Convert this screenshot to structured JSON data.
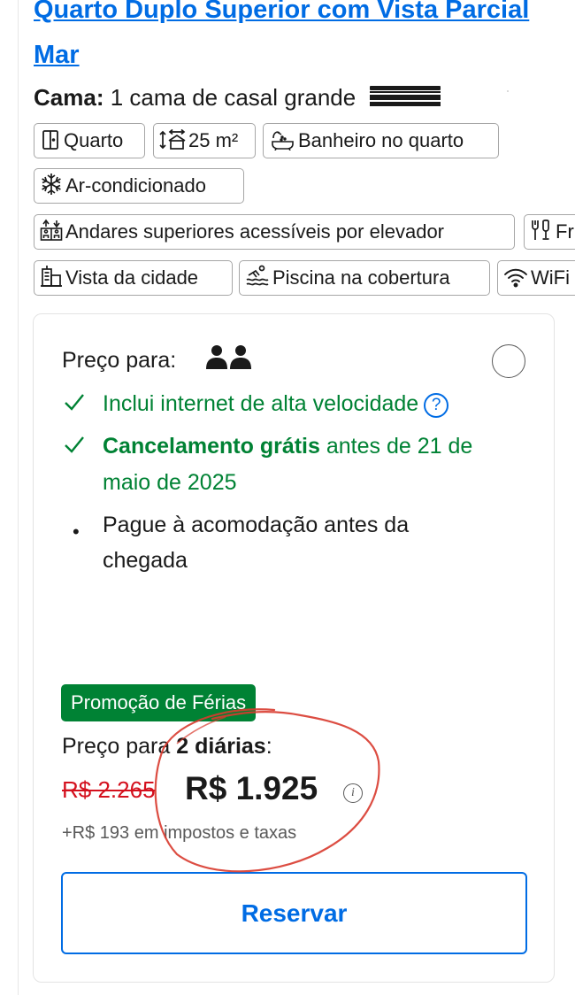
{
  "room": {
    "title_line1": "Quarto Duplo Superior com Vista Parcial",
    "title_line2": "Mar",
    "bed_label": "Cama:",
    "bed_value": "1 cama de casal grande"
  },
  "amenities": [
    {
      "label": "Quarto",
      "icon": "door-icon"
    },
    {
      "label": "25 m²",
      "icon": "room-size-icon"
    },
    {
      "label": "Banheiro no quarto",
      "icon": "bath-icon"
    },
    {
      "label": "Ar-condicionado",
      "icon": "snowflake-icon"
    },
    {
      "label": "Andares superiores acessíveis por elevador",
      "icon": "elevator-icon"
    },
    {
      "label": "Fr",
      "icon": "minibar-icon"
    },
    {
      "label": "Vista da cidade",
      "icon": "city-icon"
    },
    {
      "label": "Piscina na cobertura",
      "icon": "pool-icon"
    },
    {
      "label": "WiFi",
      "icon": "wifi-icon"
    }
  ],
  "offer": {
    "price_for_label": "Preço para:",
    "perks": [
      {
        "text": "Inclui internet de alta velocidade",
        "help": "?"
      },
      {
        "bold": "Cancelamento grátis",
        "text": " antes de 21 de maio de 2025"
      }
    ],
    "payment_note": "Pague à acomodação antes da chegada",
    "promo_badge": "Promoção de Férias",
    "nights_prefix": "Preço para ",
    "nights_bold": "2 diárias",
    "nights_suffix": ":",
    "old_price": "R$ 2.265",
    "new_price": "R$ 1.925",
    "info_glyph": "i",
    "taxes": "+R$ 193 em impostos e taxas",
    "reserve_label": "Reservar"
  },
  "colors": {
    "link_blue": "#006ce4",
    "green": "#008234",
    "red_strike": "#d4111e",
    "annotation_red": "#d83a2e"
  }
}
